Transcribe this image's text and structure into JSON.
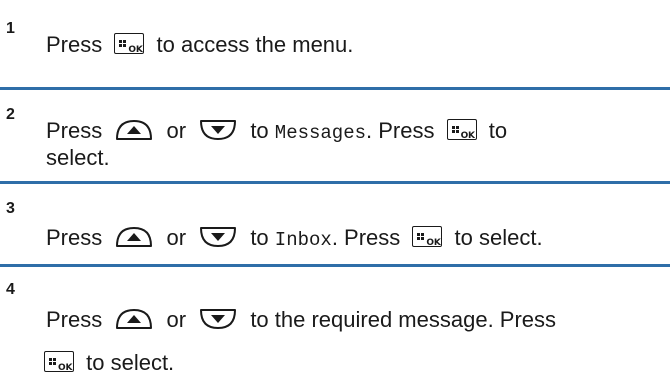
{
  "steps": [
    {
      "number": "1",
      "press": "Press",
      "after_ok": "to access the menu."
    },
    {
      "number": "2",
      "press": "Press",
      "or": "or",
      "to": "to",
      "menu_item": "Messages",
      "period_press": ". Press",
      "to_end": "to",
      "line2": "select."
    },
    {
      "number": "3",
      "press": "Press",
      "or": "or",
      "to": "to",
      "menu_item": "Inbox",
      "period_press": ". Press",
      "after_ok": "to select."
    },
    {
      "number": "4",
      "press": "Press",
      "or": "or",
      "rest": "to the required message. Press",
      "line2_after_ok": "to select."
    }
  ],
  "icons": {
    "ok_key_label": "OK",
    "ok_key": "menu-ok-key-icon",
    "up_key": "up-arrow-key-icon",
    "down_key": "down-arrow-key-icon"
  },
  "colors": {
    "divider": "#2f6ea8",
    "text": "#1a1a1a"
  }
}
